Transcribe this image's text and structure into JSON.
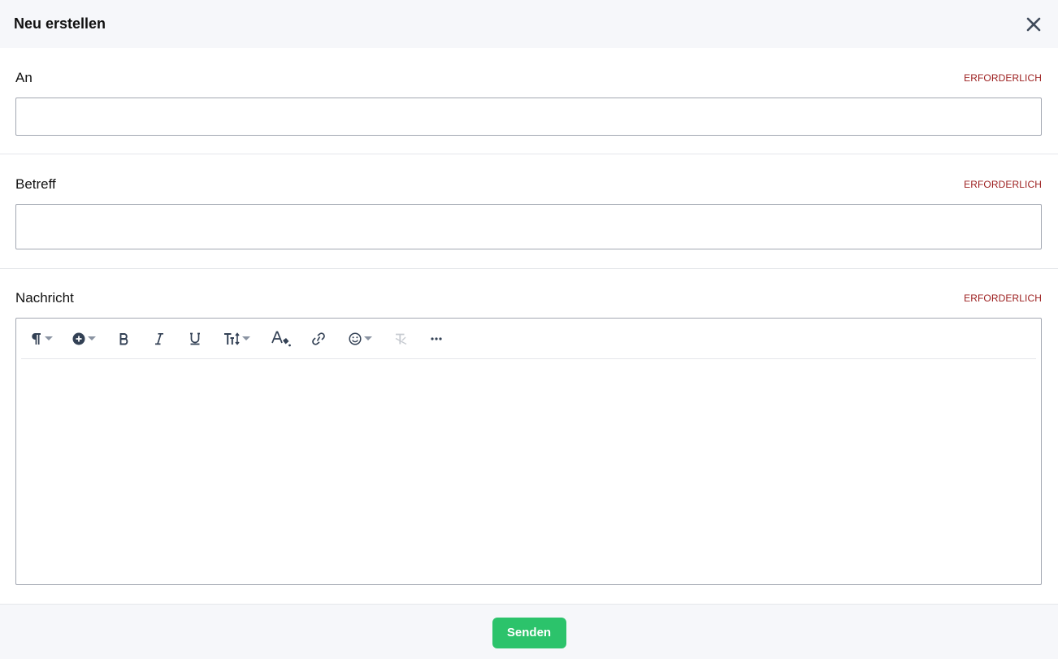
{
  "header": {
    "title": "Neu erstellen",
    "close_icon": "close-icon"
  },
  "fields": {
    "to": {
      "label": "An",
      "required": "ERFORDERLICH",
      "value": "",
      "placeholder": ""
    },
    "subject": {
      "label": "Betreff",
      "required": "ERFORDERLICH",
      "value": "",
      "placeholder": ""
    },
    "message": {
      "label": "Nachricht",
      "required": "ERFORDERLICH",
      "value": ""
    }
  },
  "toolbar": {
    "buttons": [
      {
        "icon": "paragraph-format-icon",
        "dropdown": true
      },
      {
        "icon": "insert-plus-icon",
        "dropdown": true
      },
      {
        "icon": "bold-icon",
        "dropdown": false
      },
      {
        "icon": "italic-icon",
        "dropdown": false
      },
      {
        "icon": "underline-icon",
        "dropdown": false
      },
      {
        "icon": "font-size-icon",
        "dropdown": true
      },
      {
        "icon": "text-color-icon",
        "dropdown": false
      },
      {
        "icon": "link-icon",
        "dropdown": false
      },
      {
        "icon": "emoji-icon",
        "dropdown": true
      },
      {
        "icon": "clear-formatting-icon",
        "dropdown": false,
        "disabled": true
      },
      {
        "icon": "more-options-icon",
        "dropdown": false
      }
    ]
  },
  "footer": {
    "send_label": "Senden"
  },
  "colors": {
    "header_bg": "#f6f7fa",
    "required_text": "#9b1c1c",
    "send_button": "#2cc36b",
    "icon": "#334155",
    "icon_disabled": "#c7cbd1"
  }
}
